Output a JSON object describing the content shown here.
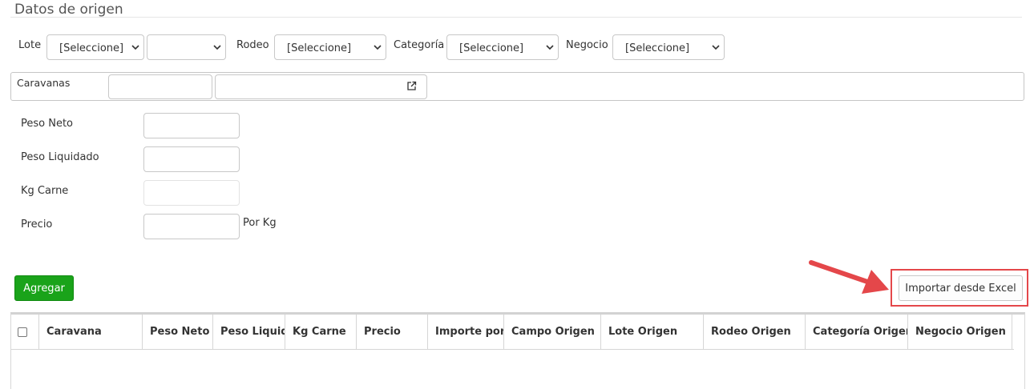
{
  "section": {
    "title": "Datos de origen"
  },
  "filters": {
    "lote": {
      "label": "Lote",
      "select1": "[Seleccione]",
      "select2": ""
    },
    "rodeo": {
      "label": "Rodeo",
      "select": "[Seleccione]"
    },
    "categoria": {
      "label": "Categoría",
      "select": "[Seleccione]"
    },
    "negocio": {
      "label": "Negocio",
      "select": "[Seleccione]"
    }
  },
  "caravanas": {
    "label": "Caravanas",
    "input1": "",
    "input2": "",
    "link_icon": "external-link-icon"
  },
  "form": {
    "peso_neto": {
      "label": "Peso Neto",
      "value": ""
    },
    "peso_liquidado": {
      "label": "Peso Liquidado",
      "value": ""
    },
    "kg_carne": {
      "label": "Kg Carne",
      "value": ""
    },
    "precio": {
      "label": "Precio",
      "value": "",
      "suffix": "Por Kg"
    }
  },
  "actions": {
    "agregar": "Agregar",
    "importar": "Importar desde Excel"
  },
  "grid": {
    "columns": [
      "Caravana",
      "Peso Neto",
      "Peso Liquidado",
      "Kg Carne",
      "Precio",
      "Importe por",
      "Campo Origen",
      "Lote Origen",
      "Rodeo Origen",
      "Categoría Origen",
      "Negocio Origen"
    ]
  },
  "colors": {
    "primary_green": "#1aa31a",
    "annotation_red": "#e4474a"
  }
}
